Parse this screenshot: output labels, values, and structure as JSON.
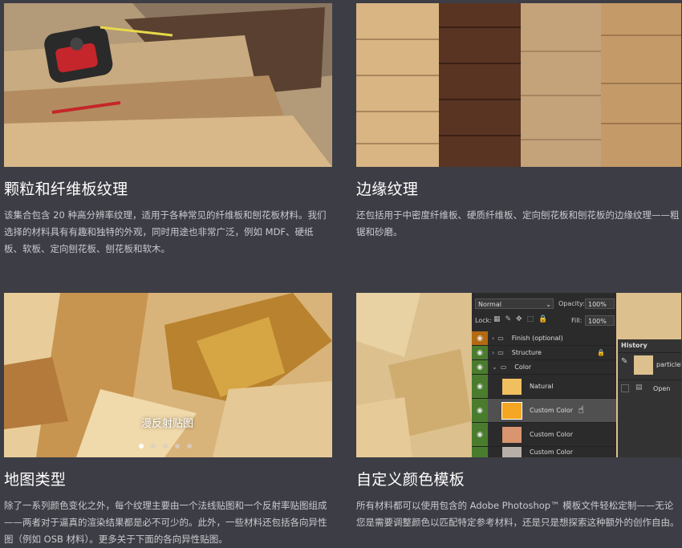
{
  "cards": [
    {
      "title": "颗粒和纤维板纹理",
      "description": "该集合包含 20 种高分辨率纹理，适用于各种常见的纤维板和刨花板材料。我们选择的材料具有有趣和独特的外观，同时用途也非常广泛，例如 MDF、硬纸板、软板、定向刨花板、刨花板和软木。"
    },
    {
      "title": "边缘纹理",
      "description": "还包括用于中密度纤维板、硬质纤维板、定向刨花板和刨花板的边缘纹理——粗锯和砂磨。"
    },
    {
      "title": "地图类型",
      "description": "除了一系列颜色变化之外，每个纹理主要由一个法线贴图和一个反射率贴图组成——两者对于逼真的渲染结果都是必不可少的。此外，一些材料还包括各向异性图（例如 OSB 材料）。更多关于下面的各向异性贴图。",
      "slider_caption": "漫反射贴图",
      "slider_dots": 5,
      "slider_active": 0
    },
    {
      "title": "自定义颜色模板",
      "description": "所有材料都可以使用包含的 Adobe Photoshop™ 模板文件轻松定制——无论您是需要调整颜色以匹配特定参考材料，还是只是想探索这种额外的创作自由。"
    }
  ],
  "photoshop": {
    "blend_mode": "Normal",
    "opacity_label": "Opacity:",
    "opacity_value": "100%",
    "lock_label": "Lock:",
    "fill_label": "Fill:",
    "fill_value": "100%",
    "layers": [
      {
        "name": "Finish (optional)",
        "type": "group"
      },
      {
        "name": "Structure",
        "type": "group"
      },
      {
        "name": "Color",
        "type": "group"
      },
      {
        "name": "Natural",
        "type": "layer",
        "swatch": "#f0c060"
      },
      {
        "name": "Custom Color",
        "type": "layer",
        "swatch": "#f5a623"
      },
      {
        "name": "Custom Color",
        "type": "layer",
        "swatch": "#d89570"
      },
      {
        "name": "Custom Color",
        "type": "layer",
        "swatch": "#b8b0a8"
      }
    ],
    "history_title": "History",
    "history_items": [
      {
        "label": "particleb"
      },
      {
        "label": "Open"
      }
    ]
  }
}
